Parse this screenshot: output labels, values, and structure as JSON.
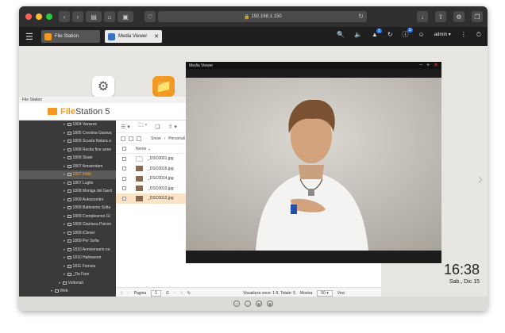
{
  "browser": {
    "url": "192.168.1.150"
  },
  "qts": {
    "tabs": [
      {
        "label": "File Station"
      },
      {
        "label": "Media Viewer"
      }
    ],
    "notifications_badge": "1",
    "info_badge": "1",
    "user": "admin"
  },
  "desktop": {
    "time": "16:38",
    "date": "Sab., Dic 15"
  },
  "file_station": {
    "window_title": "File Station",
    "brand_name": "File",
    "brand_suffix": "Station 5",
    "folders": [
      {
        "label": "1804 Varazze"
      },
      {
        "label": "1805 Cresima Garava"
      },
      {
        "label": "1805 Scuola Natura a"
      },
      {
        "label": "1806 Recita fine anno"
      },
      {
        "label": "1806 Skate"
      },
      {
        "label": "1807 Amsterdam"
      },
      {
        "label": "1807 Fitbit"
      },
      {
        "label": "1807 Luglio"
      },
      {
        "label": "1808 Moniga del Gard"
      },
      {
        "label": "1809 Autoscontro"
      },
      {
        "label": "1809 Battesimo Sofia"
      },
      {
        "label": "1809 Compleanno Gi"
      },
      {
        "label": "1809 Gianluca Psicon"
      },
      {
        "label": "1809 iClever"
      },
      {
        "label": "1809 Per Sofia"
      },
      {
        "label": "1810 Anniversario no"
      },
      {
        "label": "1810 Halloween"
      },
      {
        "label": "1811 Ferrara"
      },
      {
        "label": "_Da Fare"
      }
    ],
    "parent_folders": [
      {
        "label": "Vettoriali"
      },
      {
        "label": "Web"
      }
    ],
    "crumbs": [
      "Snow",
      "Personali"
    ],
    "column_name": "Nome",
    "files": [
      {
        "name": "_DSC0021.jpg"
      },
      {
        "name": "_DSC0016.jpg"
      },
      {
        "name": "_DSC0014.jpg"
      },
      {
        "name": "_DSC0013.jpg"
      },
      {
        "name": "_DSC0012.jpg"
      }
    ],
    "footer": {
      "page_label": "Pagina",
      "page_value": "1",
      "page_total": "/1",
      "summary": "Visualizza voce: 1-5, Totale: 5",
      "show_label": "Mostra",
      "show_value": "50",
      "items_label": "Voci"
    }
  },
  "media_viewer": {
    "title": "Media Viewer"
  },
  "colors": {
    "accent": "#f09a24",
    "sidebar_bg": "#3a3a3a",
    "selection": "#fbe3c6"
  }
}
